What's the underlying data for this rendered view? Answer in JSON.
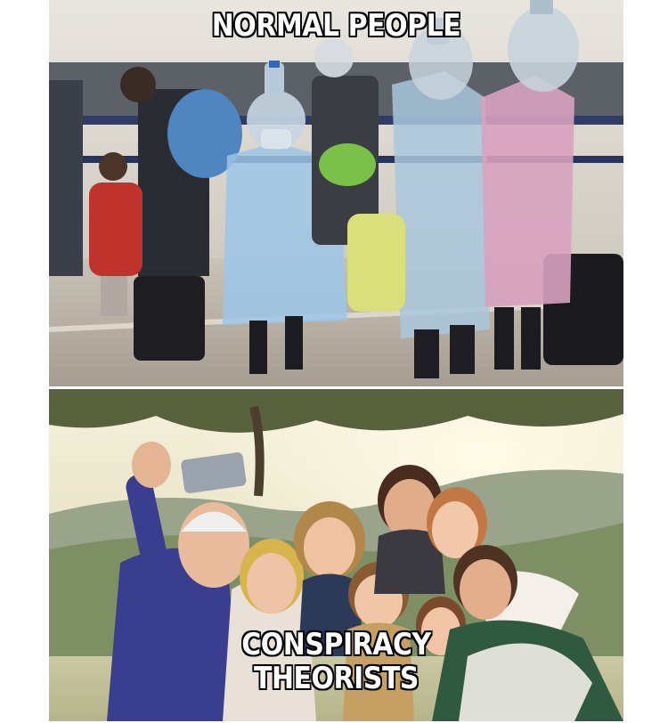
{
  "meme": {
    "top_caption": "NORMAL PEOPLE",
    "bottom_caption_line1": "CONSPIRACY",
    "bottom_caption_line2": "THEORISTS"
  },
  "colors": {
    "background": "#ffffff",
    "caption_fill": "#ffffff",
    "caption_outline": "#000000"
  }
}
